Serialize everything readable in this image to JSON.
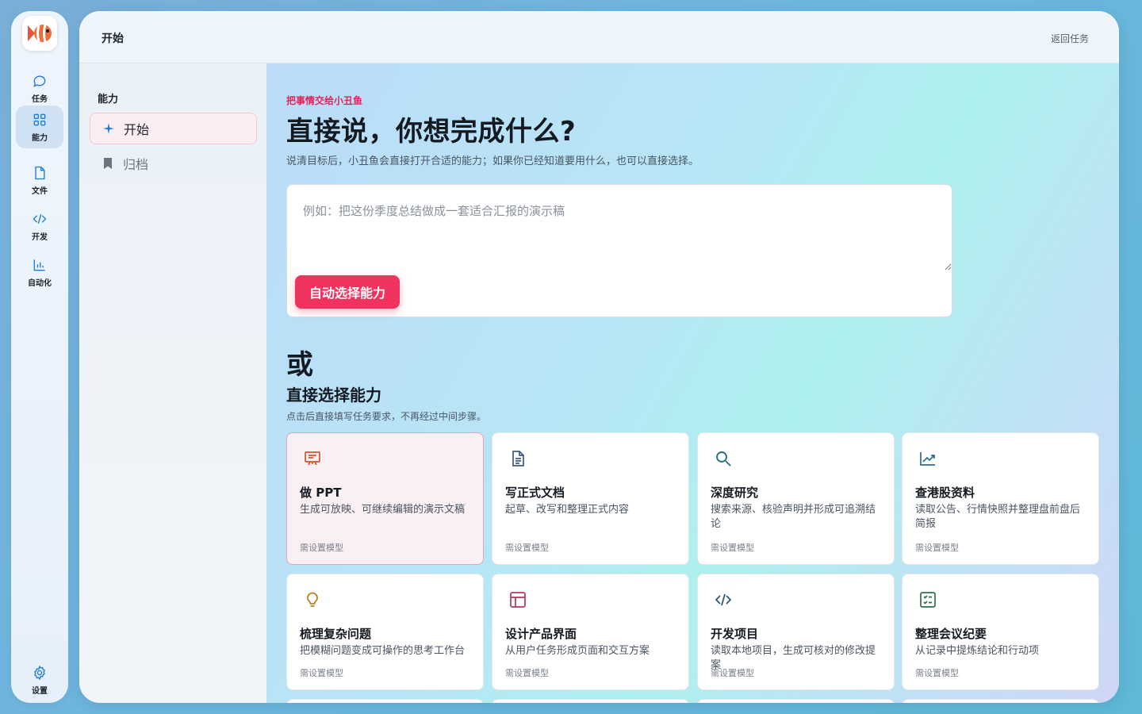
{
  "rail": {
    "items": [
      {
        "label": "任务",
        "icon": "chat-bubble-icon"
      },
      {
        "label": "能力",
        "icon": "grid-icon"
      },
      {
        "label": "文件",
        "icon": "file-icon"
      },
      {
        "label": "开发",
        "icon": "code-icon"
      },
      {
        "label": "自动化",
        "icon": "chart-icon"
      }
    ],
    "settings_label": "设置",
    "active_index": 1
  },
  "header": {
    "title": "开始",
    "back_label": "返回任务"
  },
  "subnav": {
    "heading": "能力",
    "items": [
      {
        "label": "开始",
        "icon": "sparkle-icon"
      },
      {
        "label": "归档",
        "icon": "bookmark-icon"
      }
    ]
  },
  "main": {
    "eyebrow": "把事情交给小丑鱼",
    "hero": "直接说，你想完成什么?",
    "subtitle": "说清目标后，小丑鱼会直接打开合适的能力；如果你已经知道要用什么，也可以直接选择。",
    "prompt_placeholder": "例如：把这份季度总结做成一套适合汇报的演示稿",
    "auto_button": "自动选择能力",
    "or_text": "或",
    "section_title": "直接选择能力",
    "section_sub": "点击后直接填写任务要求，不再经过中间步骤。"
  },
  "cards": [
    {
      "title": "做 PPT",
      "desc": "生成可放映、可继续编辑的演示文稿",
      "footer": "需设置模型",
      "icon": "presentation-icon",
      "color": "#d4552b"
    },
    {
      "title": "写正式文档",
      "desc": "起草、改写和整理正式内容",
      "footer": "需设置模型",
      "icon": "document-icon",
      "color": "#3f5b7a"
    },
    {
      "title": "深度研究",
      "desc": "搜索来源、核验声明并形成可追溯结论",
      "footer": "需设置模型",
      "icon": "search-icon",
      "color": "#2b6a88"
    },
    {
      "title": "查港股资料",
      "desc": "读取公告、行情快照并整理盘前盘后简报",
      "footer": "需设置模型",
      "icon": "trend-chart-icon",
      "color": "#2c6e8e"
    },
    {
      "title": "梳理复杂问题",
      "desc": "把模糊问题变成可操作的思考工作台",
      "footer": "需设置模型",
      "icon": "lightbulb-icon",
      "color": "#b8801d"
    },
    {
      "title": "设计产品界面",
      "desc": "从用户任务形成页面和交互方案",
      "footer": "需设置模型",
      "icon": "layout-icon",
      "color": "#b03a5b"
    },
    {
      "title": "开发项目",
      "desc": "读取本地项目，生成可核对的修改提案",
      "footer": "需设置模型",
      "icon": "code-icon",
      "color": "#2e5a78"
    },
    {
      "title": "整理会议纪要",
      "desc": "从记录中提炼结论和行动项",
      "footer": "需设置模型",
      "icon": "checklist-icon",
      "color": "#2f6f4a"
    }
  ]
}
